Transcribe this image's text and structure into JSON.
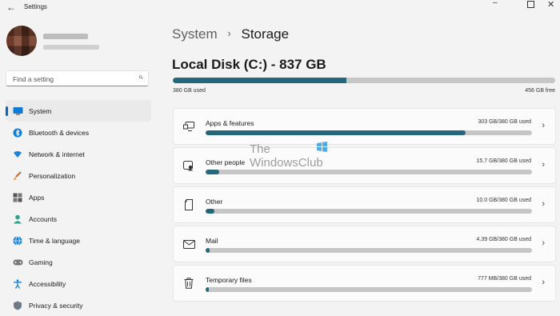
{
  "window": {
    "title": "Settings"
  },
  "sidebar": {
    "search_placeholder": "Find a setting",
    "items": [
      {
        "label": "System",
        "icon": "system-icon",
        "active": true
      },
      {
        "label": "Bluetooth & devices",
        "icon": "bluetooth-icon"
      },
      {
        "label": "Network & internet",
        "icon": "network-icon"
      },
      {
        "label": "Personalization",
        "icon": "brush-icon"
      },
      {
        "label": "Apps",
        "icon": "apps-icon"
      },
      {
        "label": "Accounts",
        "icon": "accounts-icon"
      },
      {
        "label": "Time & language",
        "icon": "globe-icon"
      },
      {
        "label": "Gaming",
        "icon": "gaming-icon"
      },
      {
        "label": "Accessibility",
        "icon": "accessibility-icon"
      },
      {
        "label": "Privacy & security",
        "icon": "shield-icon"
      }
    ]
  },
  "breadcrumb": {
    "parent": "System",
    "separator": "›",
    "current": "Storage"
  },
  "disk": {
    "title": "Local Disk (C:) - 837 GB",
    "used_label": "380 GB used",
    "free_label": "456 GB free",
    "used_fraction": 0.454
  },
  "categories": [
    {
      "name": "Apps & features",
      "usage": "303 GB/380 GB used",
      "fraction": 0.797,
      "icon": "apps-features-icon"
    },
    {
      "name": "Other people",
      "usage": "15.7 GB/380 GB used",
      "fraction": 0.041,
      "icon": "other-people-icon"
    },
    {
      "name": "Other",
      "usage": "10.0 GB/380 GB used",
      "fraction": 0.026,
      "icon": "document-icon"
    },
    {
      "name": "Mail",
      "usage": "4.39 GB/380 GB used",
      "fraction": 0.012,
      "icon": "mail-icon"
    },
    {
      "name": "Temporary files",
      "usage": "777 MB/380 GB used",
      "fraction": 0.002,
      "icon": "trash-icon"
    }
  ],
  "watermark": {
    "line1": "The",
    "line2": "WindowsClub"
  },
  "colors": {
    "accent": "#0067c0",
    "bar_fill": "#24677a",
    "bar_track": "#c6c6c6"
  }
}
